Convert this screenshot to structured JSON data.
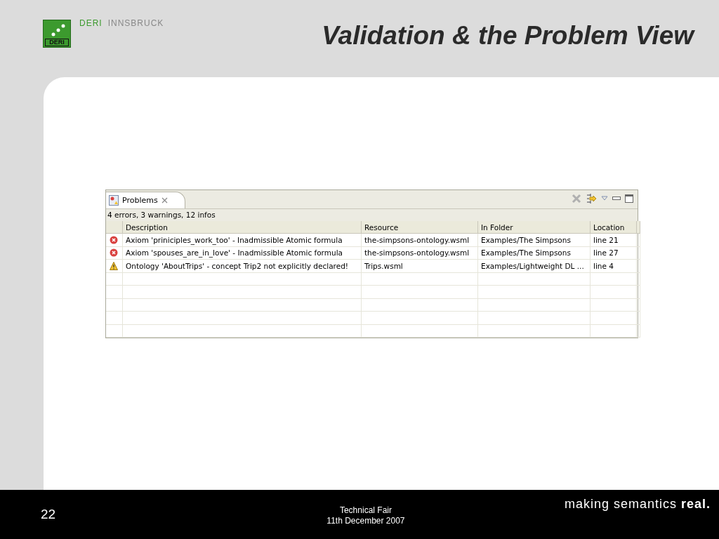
{
  "header": {
    "logo_text": "DERI",
    "brand": "DERI",
    "brand_location": "INNSBRUCK",
    "title": "Validation & the Problem View"
  },
  "problems_view": {
    "tab": {
      "label": "Problems",
      "selected": true
    },
    "summary": "4 errors, 3 warnings, 12 infos",
    "table": {
      "columns": [
        "Description",
        "Resource",
        "In Folder",
        "Location"
      ],
      "rows": [
        {
          "kind": "error",
          "description": "Axiom 'priniciples_work_too' - Inadmissible Atomic formula",
          "resource": "the-simpsons-ontology.wsml",
          "folder": "Examples/The Simpsons",
          "location": "line 21"
        },
        {
          "kind": "error",
          "description": "Axiom 'spouses_are_in_love' - Inadmissible Atomic formula",
          "resource": "the-simpsons-ontology.wsml",
          "folder": "Examples/The Simpsons",
          "location": "line 27"
        },
        {
          "kind": "warning",
          "description": "Ontology 'AboutTrips' - concept Trip2 not explicitly declared!",
          "resource": "Trips.wsml",
          "folder": "Examples/Lightweight DL ...",
          "location": "line 4"
        }
      ]
    }
  },
  "footer": {
    "page": "22",
    "event": "Technical Fair",
    "date": "11th December 2007",
    "tagline": "making semantics **real.**"
  }
}
